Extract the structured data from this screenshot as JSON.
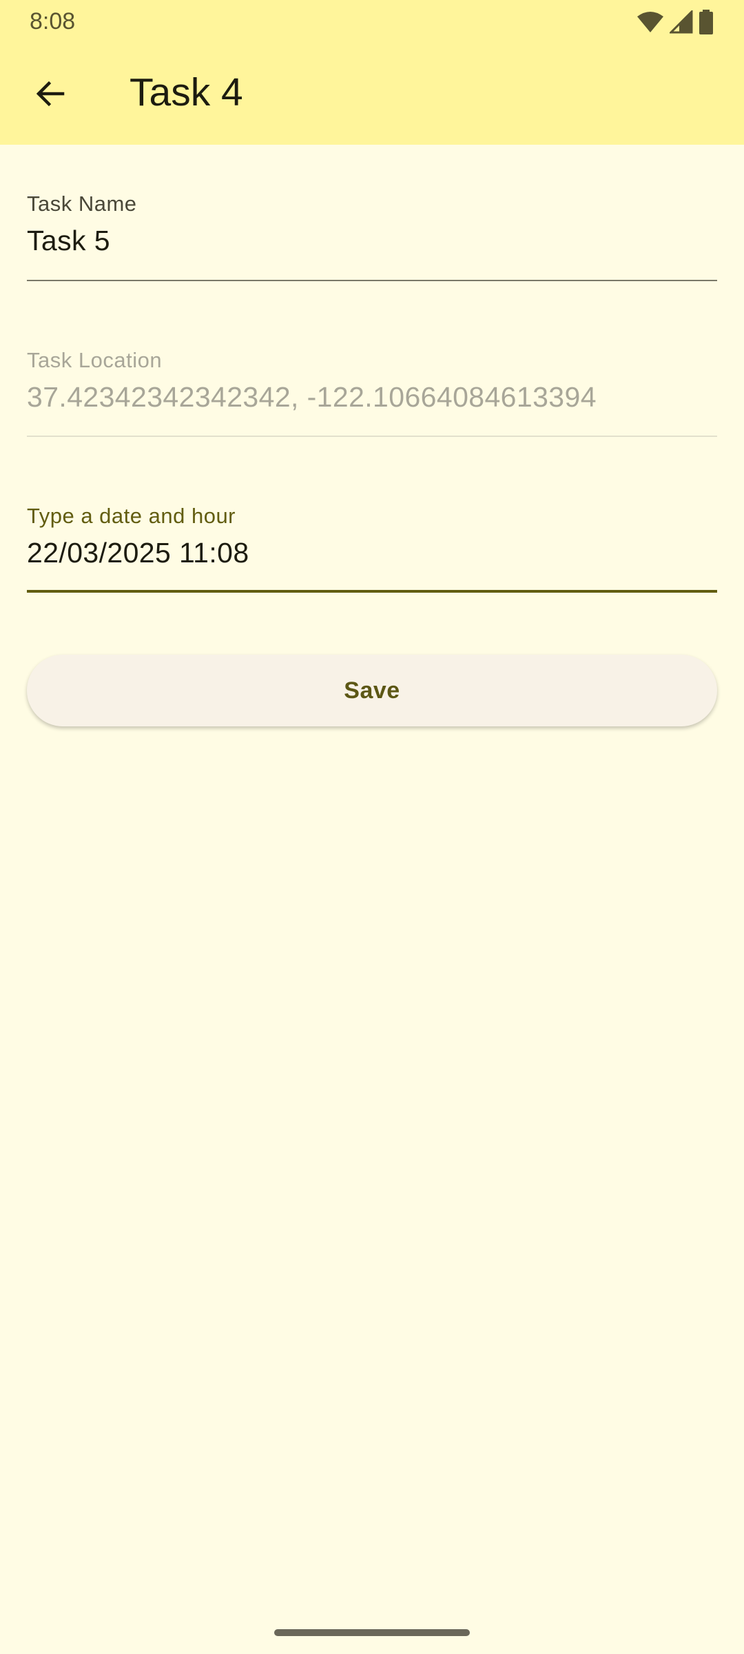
{
  "status_bar": {
    "time": "8:08",
    "icons": [
      "wifi-icon",
      "cellular-signal-icon",
      "battery-icon"
    ]
  },
  "app_bar": {
    "title": "Task 4",
    "back_icon": "arrow-left-icon"
  },
  "form": {
    "task_name": {
      "label": "Task Name",
      "value": "Task 5"
    },
    "task_location": {
      "label": "Task Location",
      "value": "37.42342342342342, -122.10664084613394"
    },
    "date_hour": {
      "label": "Type a date and hour",
      "value": "22/03/2025 11:08"
    },
    "save_label": "Save"
  },
  "colors": {
    "background": "#FFFCE4",
    "app_bar": "#FFF59B",
    "accent": "#625D10",
    "disabled_text": "#A8A698",
    "button_bg": "#F8F2E7"
  }
}
